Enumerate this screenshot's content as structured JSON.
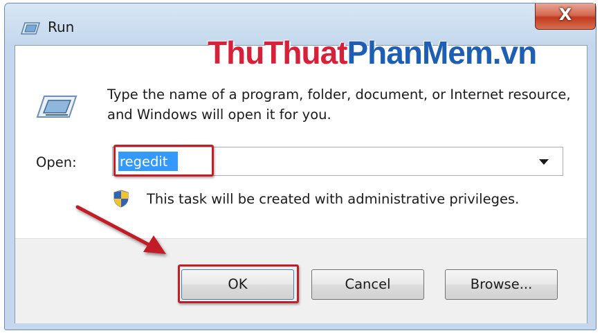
{
  "window": {
    "title": "Run",
    "close_label": "X"
  },
  "watermark": {
    "part1": "ThuThuat",
    "part2": "PhanMem.vn"
  },
  "dialog": {
    "description": "Type the name of a program, folder, document, or Internet resource, and Windows will open it for you.",
    "open_label": "Open:",
    "open_value": "regedit",
    "admin_note": "This task will be created with administrative privileges."
  },
  "buttons": {
    "ok": "OK",
    "cancel": "Cancel",
    "browse": "Browse..."
  },
  "icons": {
    "title": "run-icon",
    "main": "run-icon",
    "dropdown": "chevron-down-icon",
    "admin": "uac-shield-icon",
    "annotation": "red-arrow"
  },
  "colors": {
    "highlight": "#c21e25",
    "selection": "#3399ff",
    "watermark_red": "#d6213a",
    "watermark_blue": "#1f5fb3"
  }
}
